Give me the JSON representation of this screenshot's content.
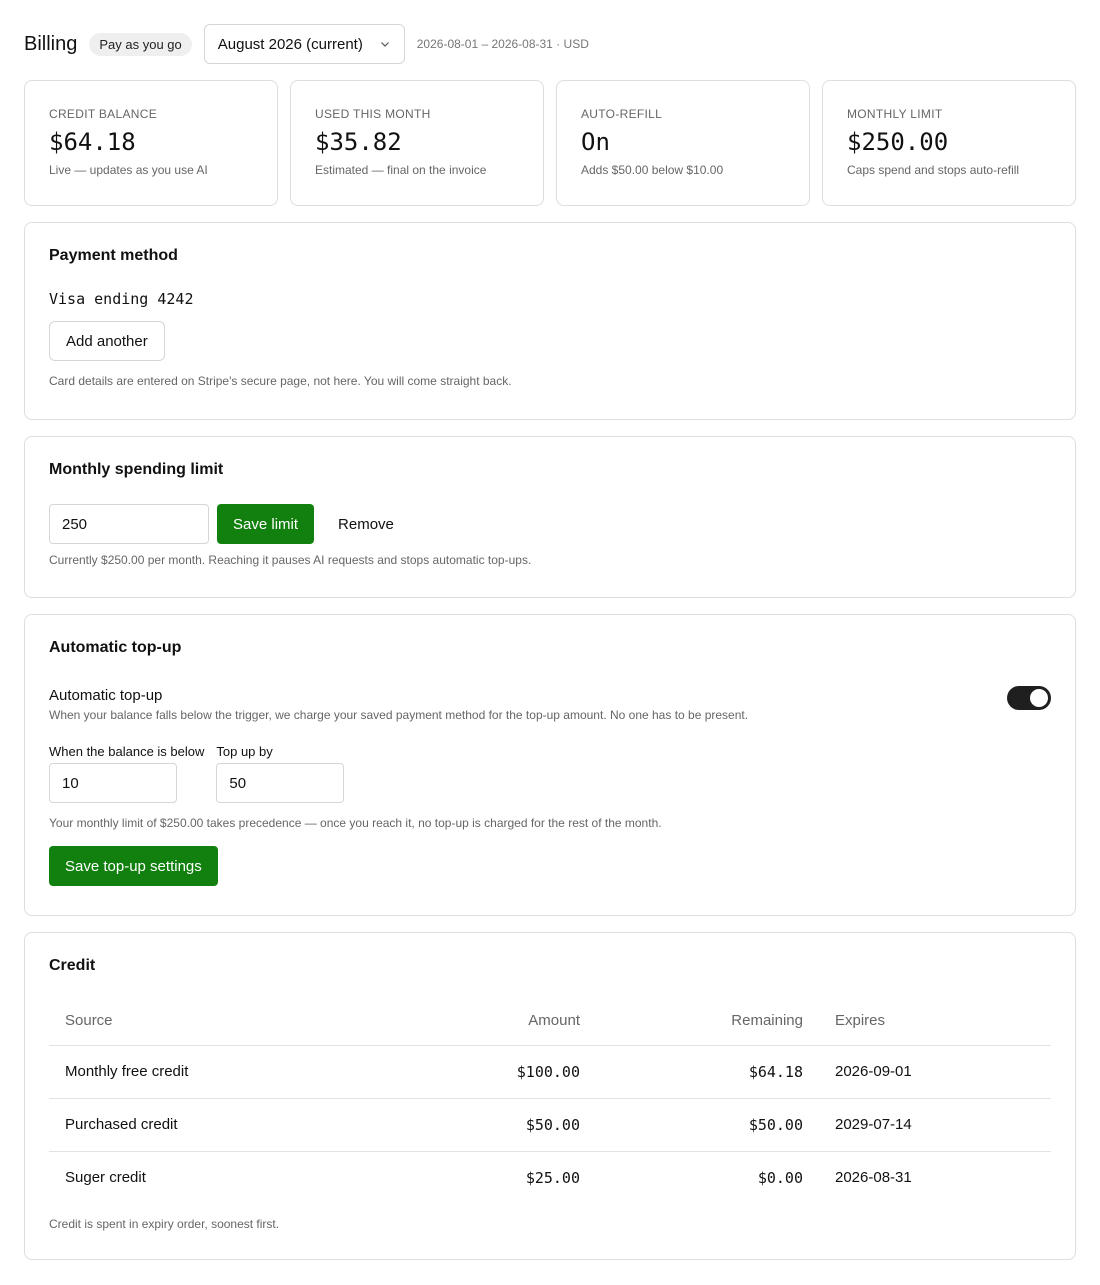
{
  "header": {
    "title": "Billing",
    "plan_badge": "Pay as you go",
    "period_select": "August 2026 (current)",
    "period_range": "2026-08-01 – 2026-08-31 · USD"
  },
  "stats": [
    {
      "label": "CREDIT BALANCE",
      "value": "$64.18",
      "sub": "Live — updates as you use AI"
    },
    {
      "label": "USED THIS MONTH",
      "value": "$35.82",
      "sub": "Estimated — final on the invoice"
    },
    {
      "label": "AUTO-REFILL",
      "value": "On",
      "sub": "Adds $50.00 below $10.00"
    },
    {
      "label": "MONTHLY LIMIT",
      "value": "$250.00",
      "sub": "Caps spend and stops auto-refill"
    }
  ],
  "payment": {
    "title": "Payment method",
    "card": "Visa ending 4242",
    "add_button": "Add another",
    "note": "Card details are entered on Stripe's secure page, not here. You will come straight back."
  },
  "limit": {
    "title": "Monthly spending limit",
    "input_value": "250",
    "save_button": "Save limit",
    "remove_button": "Remove",
    "note": "Currently $250.00 per month. Reaching it pauses AI requests and stops automatic top-ups."
  },
  "topup": {
    "title": "Automatic top-up",
    "toggle_label": "Automatic top-up",
    "toggle_desc": "When your balance falls below the trigger, we charge your saved payment method for the top-up amount. No one has to be present.",
    "toggle_on": true,
    "trigger_label": "When the balance is below",
    "trigger_value": "10",
    "amount_label": "Top up by",
    "amount_value": "50",
    "note": "Your monthly limit of $250.00 takes precedence — once you reach it, no top-up is charged for the rest of the month.",
    "save_button": "Save top-up settings"
  },
  "credit": {
    "title": "Credit",
    "columns": {
      "source": "Source",
      "amount": "Amount",
      "remaining": "Remaining",
      "expires": "Expires"
    },
    "rows": [
      {
        "source": "Monthly free credit",
        "amount": "$100.00",
        "remaining": "$64.18",
        "expires": "2026-09-01"
      },
      {
        "source": "Purchased credit",
        "amount": "$50.00",
        "remaining": "$50.00",
        "expires": "2029-07-14"
      },
      {
        "source": "Suger credit",
        "amount": "$25.00",
        "remaining": "$0.00",
        "expires": "2026-08-31"
      }
    ],
    "note": "Credit is spent in expiry order, soonest first."
  },
  "colors": {
    "primary": "#12800f",
    "toggle": "#1f1f1f",
    "border": "#dedede"
  }
}
